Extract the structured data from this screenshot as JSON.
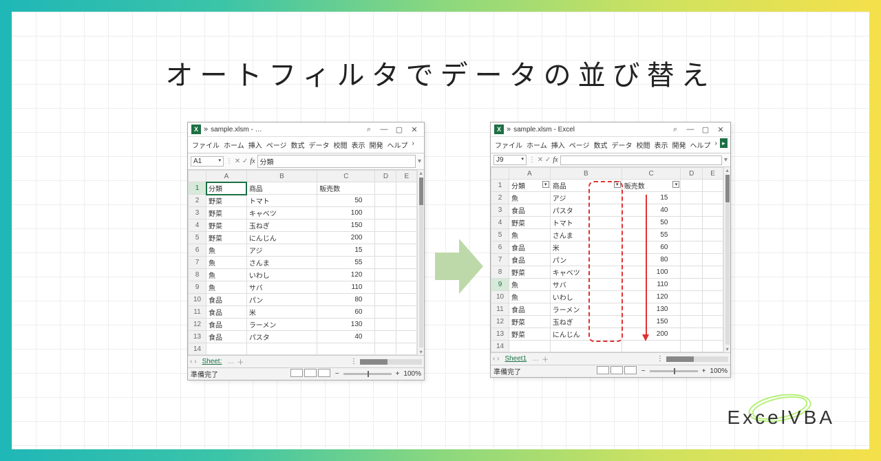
{
  "title": "オートフィルタでデータの並び替え",
  "logo": "ExcelVBA",
  "common": {
    "ribbon": [
      "ファイル",
      "ホーム",
      "挿入",
      "ページ",
      "数式",
      "データ",
      "校閲",
      "表示",
      "開発",
      "ヘルプ"
    ],
    "search_icon": "⌕",
    "minimize": "—",
    "maximize": "▢",
    "close": "✕",
    "fx": "fx",
    "status": "準備完了",
    "zoom": "100%",
    "sheet": "Sheet1",
    "sheet_short": "Sheet:",
    "plus": "＋",
    "dots": "…",
    "nav": "‹ ›"
  },
  "left": {
    "title": "sample.xlsm - …",
    "name_box": "A1",
    "formula": "分類",
    "cols": [
      "",
      "A",
      "B",
      "C",
      "D",
      "E"
    ],
    "headers": [
      "分類",
      "商品",
      "販売数"
    ],
    "rows": [
      {
        "n": 1,
        "a": "分類",
        "b": "商品",
        "c": "販売数",
        "header": true
      },
      {
        "n": 2,
        "a": "野菜",
        "b": "トマト",
        "c": 50
      },
      {
        "n": 3,
        "a": "野菜",
        "b": "キャベツ",
        "c": 100
      },
      {
        "n": 4,
        "a": "野菜",
        "b": "玉ねぎ",
        "c": 150
      },
      {
        "n": 5,
        "a": "野菜",
        "b": "にんじん",
        "c": 200
      },
      {
        "n": 6,
        "a": "魚",
        "b": "アジ",
        "c": 15
      },
      {
        "n": 7,
        "a": "魚",
        "b": "さんま",
        "c": 55
      },
      {
        "n": 8,
        "a": "魚",
        "b": "いわし",
        "c": 120
      },
      {
        "n": 9,
        "a": "魚",
        "b": "サバ",
        "c": 110
      },
      {
        "n": 10,
        "a": "食品",
        "b": "パン",
        "c": 80
      },
      {
        "n": 11,
        "a": "食品",
        "b": "米",
        "c": 60
      },
      {
        "n": 12,
        "a": "食品",
        "b": "ラーメン",
        "c": 130
      },
      {
        "n": 13,
        "a": "食品",
        "b": "パスタ",
        "c": 40
      }
    ]
  },
  "right": {
    "title": "sample.xlsm - Excel",
    "name_box": "J9",
    "formula": "",
    "cols": [
      "",
      "A",
      "B",
      "C",
      "D",
      "E"
    ],
    "rows": [
      {
        "n": 1,
        "a": "分類",
        "b": "商品",
        "c": "販売数",
        "header": true,
        "filter": true
      },
      {
        "n": 2,
        "a": "魚",
        "b": "アジ",
        "c": 15
      },
      {
        "n": 3,
        "a": "食品",
        "b": "パスタ",
        "c": 40
      },
      {
        "n": 4,
        "a": "野菜",
        "b": "トマト",
        "c": 50
      },
      {
        "n": 5,
        "a": "魚",
        "b": "さんま",
        "c": 55
      },
      {
        "n": 6,
        "a": "食品",
        "b": "米",
        "c": 60
      },
      {
        "n": 7,
        "a": "食品",
        "b": "パン",
        "c": 80
      },
      {
        "n": 8,
        "a": "野菜",
        "b": "キャベツ",
        "c": 100
      },
      {
        "n": 9,
        "a": "魚",
        "b": "サバ",
        "c": 110
      },
      {
        "n": 10,
        "a": "魚",
        "b": "いわし",
        "c": 120
      },
      {
        "n": 11,
        "a": "食品",
        "b": "ラーメン",
        "c": 130
      },
      {
        "n": 12,
        "a": "野菜",
        "b": "玉ねぎ",
        "c": 150
      },
      {
        "n": 13,
        "a": "野菜",
        "b": "にんじん",
        "c": 200
      }
    ]
  }
}
